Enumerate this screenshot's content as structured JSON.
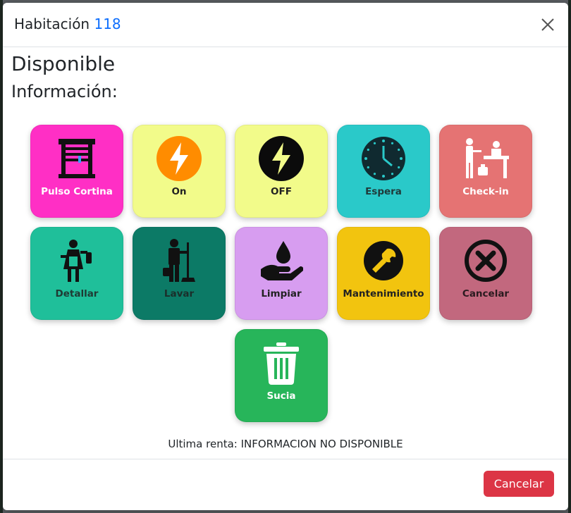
{
  "modal": {
    "title_prefix": "Habitación",
    "room_number": "118",
    "status": "Disponible",
    "info_label": "Información:",
    "last_rent": "Ultima renta: INFORMACION NO DISPONIBLE",
    "footer_cancel": "Cancelar"
  },
  "actions": [
    {
      "label": "Pulso Cortina",
      "icon": "curtain-icon",
      "bg": "#ff2fc5",
      "text_color": "#ffffff"
    },
    {
      "label": "On",
      "icon": "bolt-on-icon",
      "bg": "#f2fb8a",
      "text_color": "#222222"
    },
    {
      "label": "OFF",
      "icon": "bolt-off-icon",
      "bg": "#f2fb8a",
      "text_color": "#222222"
    },
    {
      "label": "Espera",
      "icon": "clock-icon",
      "bg": "#2ac9c9",
      "text_color": "#1f3a3a"
    },
    {
      "label": "Check-in",
      "icon": "reception-icon",
      "bg": "#e57373",
      "text_color": "#ffffff"
    },
    {
      "label": "Detallar",
      "icon": "maid-icon",
      "bg": "#1fbf9a",
      "text_color": "#1f3a33"
    },
    {
      "label": "Lavar",
      "icon": "janitor-icon",
      "bg": "#0c7a66",
      "text_color": "#1b2e2a"
    },
    {
      "label": "Limpiar",
      "icon": "hand-drop-icon",
      "bg": "#d79df0",
      "text_color": "#222222"
    },
    {
      "label": "Mantenimiento",
      "icon": "wrench-icon",
      "bg": "#f2c40f",
      "text_color": "#222222"
    },
    {
      "label": "Cancelar",
      "icon": "x-circle-icon",
      "bg": "#c2687e",
      "text_color": "#2a1a1f"
    },
    {
      "label": "Sucia",
      "icon": "trash-icon",
      "bg": "#27b55a",
      "text_color": "#ffffff"
    }
  ]
}
